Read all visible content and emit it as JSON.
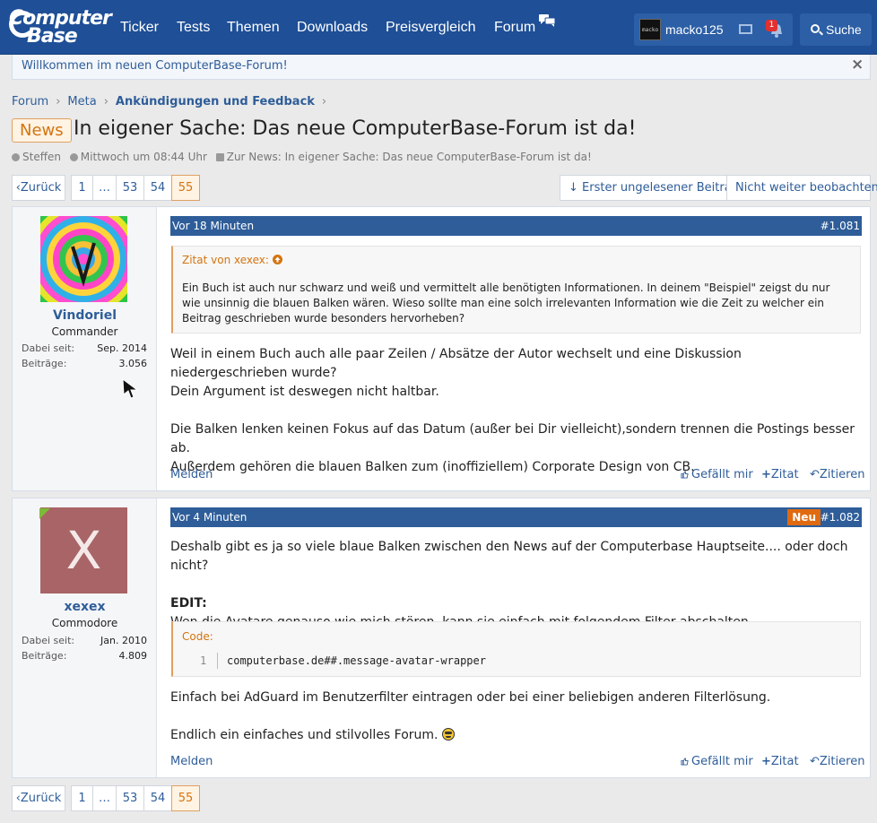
{
  "header": {
    "logo_line1": "Computer",
    "logo_line2": "Base",
    "nav": [
      {
        "label": "Ticker"
      },
      {
        "label": "Tests"
      },
      {
        "label": "Themen"
      },
      {
        "label": "Downloads"
      },
      {
        "label": "Preisvergleich"
      },
      {
        "label": "Forum"
      }
    ],
    "user": {
      "name": "macko125",
      "avatar_text": "macko"
    },
    "notification_count": "1",
    "search_label": "Suche"
  },
  "notice": {
    "text": "Willkommen im neuen ComputerBase-Forum!",
    "close": "×"
  },
  "breadcrumb": [
    {
      "label": "Forum"
    },
    {
      "label": "Meta"
    },
    {
      "label": "Ankündigungen und Feedback"
    }
  ],
  "thread": {
    "prefix": "News",
    "title": "In eigener Sache: Das neue ComputerBase-Forum ist da!",
    "author": "Steffen",
    "date": "Mittwoch um 08:44 Uhr",
    "link": "Zur News: In eigener Sache: Das neue ComputerBase-Forum ist da!"
  },
  "pagination": {
    "prev": "Zurück",
    "pages": [
      "1",
      "…",
      "53",
      "54",
      "55"
    ],
    "current": "55",
    "first_unread": "↓ Erster ungelesener Beitrag",
    "unwatch": "Nicht weiter beobachten"
  },
  "posts": [
    {
      "user": "Vindoriel",
      "rank": "Commander",
      "joined_label": "Dabei seit:",
      "joined": "Sep. 2014",
      "posts_label": "Beiträge:",
      "posts": "3.056",
      "time": "Vor 18 Minuten",
      "number": "#1.081",
      "quote_head": "Zitat von xexex:",
      "quote_body": "Ein Buch ist auch nur schwarz und weiß und vermittelt alle benötigten Informationen. In deinem \"Beispiel\" zeigst du nur wie unsinnig die blauen Balken wären. Wieso sollte man eine solch irrelevanten Information wie die Zeit zu welcher ein Beitrag geschrieben wurde besonders hervorheben?",
      "p1": "Weil in einem Buch auch alle paar Zeilen / Absätze der Autor wechselt und eine Diskussion niedergeschrieben wurde?",
      "p2": "Dein Argument ist deswegen nicht haltbar.",
      "p3": "Die Balken lenken keinen Fokus auf das Datum (außer bei Dir vielleicht),sondern trennen die Postings besser ab.",
      "p4": "Außerdem gehören die blauen Balken zum (inoffiziellem) Corporate Design von CB."
    },
    {
      "user": "xexex",
      "avatar_letter": "X",
      "rank": "Commodore",
      "joined_label": "Dabei seit:",
      "joined": "Jan. 2010",
      "posts_label": "Beiträge:",
      "posts": "4.809",
      "time": "Vor 4 Minuten",
      "new_badge": "Neu",
      "number": "#1.082",
      "p1": "Deshalb gibt es ja so viele blaue Balken zwischen den News auf der Computerbase Hauptseite.... oder doch nicht?",
      "edit": "EDIT:",
      "p2": "Wen die Avatare genauso wie mich stören, kann sie einfach mit folgendem Filter abschalten.",
      "code_head": "Code:",
      "code_line_no": "1",
      "code": "computerbase.de##.message-avatar-wrapper",
      "p3": "Einfach bei AdGuard im Benutzerfilter eintragen oder bei einer beliebigen anderen Filterlösung.",
      "p4": "Endlich ein einfaches und stilvolles Forum."
    }
  ],
  "actions": {
    "report": "Melden",
    "like": "Gefällt mir",
    "quote": "Zitat",
    "reply": "Zitieren"
  },
  "colors": {
    "brand_blue": "#1e4f97",
    "accent_orange": "#d4740f",
    "link": "#2e5d99"
  }
}
